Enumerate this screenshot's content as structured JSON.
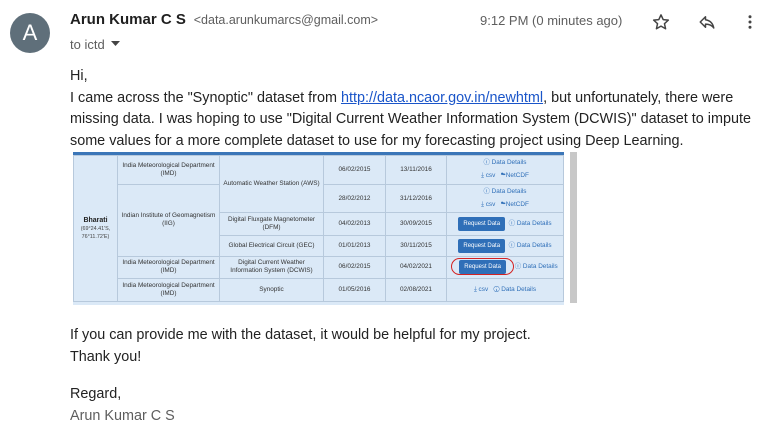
{
  "sender": {
    "avatar_letter": "A",
    "name": "Arun Kumar C S",
    "email": "<data.arunkumarcs@gmail.com>",
    "time": "9:12 PM (0 minutes ago)",
    "to": "to ictd"
  },
  "icons": [
    "star-icon",
    "reply-icon",
    "more-vert-icon",
    "chevron-down-icon"
  ],
  "body": {
    "greeting": "Hi,",
    "para1_a": "I came across the \"Synoptic\" dataset from ",
    "link": "http://data.ncaor.gov.in/newhtml",
    "para1_b": ", but unfortunately, there were missing data. I was hoping to use \"Digital Current Weather Information System (DCWIS)\" dataset to impute some values for a more complete dataset to use for my forecasting project using Deep Learning.",
    "para2": "If you can provide me with the dataset, it would be helpful for my project.",
    "thanks": "Thank you!",
    "regard": "Regard,",
    "signature": "Arun Kumar C S"
  },
  "table": {
    "station": "Bharati",
    "coords": "(69°24.41'S, 76°11.72'E)",
    "rows": [
      {
        "org": "India Meteorological Department (IMD)",
        "instrument": "Automatic Weather Station (AWS)",
        "start": "06/02/2015",
        "end": "13/11/2016",
        "details": "Data Details",
        "csv": "csv",
        "netcdf": "NetCDF"
      },
      {
        "org": "Indian Institute of Geomagnetism (IIG)",
        "instrument": "",
        "start": "28/02/2012",
        "end": "31/12/2016",
        "details": "Data Details",
        "csv": "csv",
        "netcdf": "NetCDF"
      },
      {
        "org": "",
        "instrument": "Digital Fluxgate Magnetometer (DFM)",
        "start": "04/02/2013",
        "end": "30/09/2015",
        "request": "Request Data",
        "details": "Data Details"
      },
      {
        "org": "",
        "instrument": "Global Electrical Circuit (GEC)",
        "start": "01/01/2013",
        "end": "30/11/2015",
        "request": "Request Data",
        "details": "Data Details"
      },
      {
        "org": "India Meteorological Department (IMD)",
        "instrument": "Digital Current Weather Information System (DCWIS)",
        "start": "06/02/2015",
        "end": "04/02/2021",
        "request": "Request Data",
        "details": "Data Details"
      },
      {
        "org": "India Meteorological Department (IMD)",
        "instrument": "Synoptic",
        "start": "01/05/2016",
        "end": "02/08/2021",
        "csv": "csv",
        "details": "Data Details"
      }
    ]
  }
}
